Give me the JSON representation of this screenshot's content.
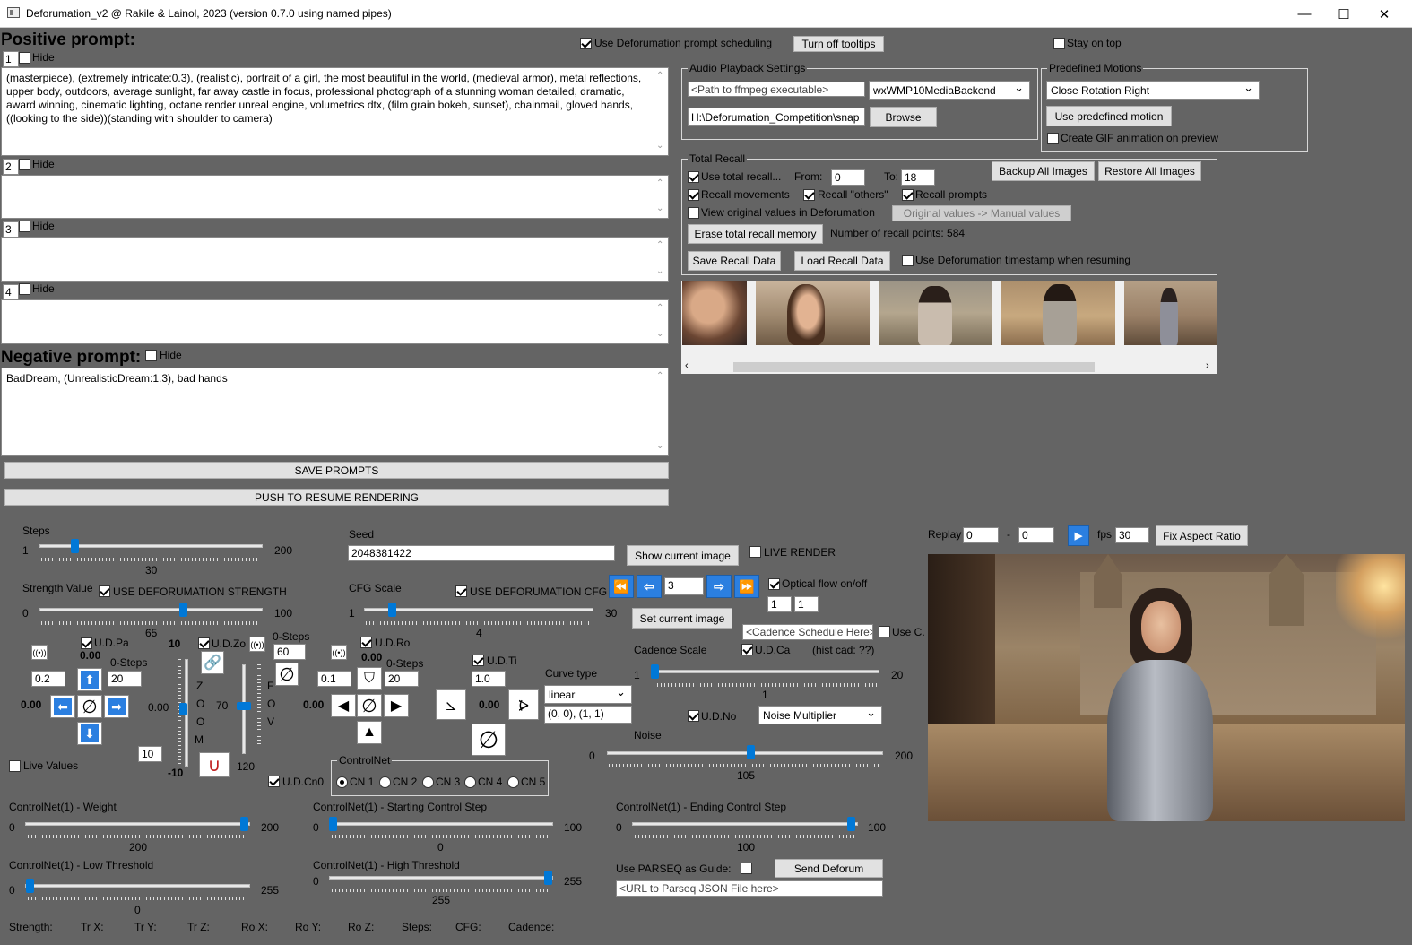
{
  "window": {
    "title": "Deforumation_v2 @ Rakile & Lainol, 2023 (version 0.7.0 using named pipes)"
  },
  "prompts": {
    "positive_header": "Positive prompt:",
    "use_scheduling": "Use Deforumation prompt scheduling",
    "turn_off_tooltips": "Turn off tooltips",
    "stay_on_top": "Stay on top",
    "hide": "Hide",
    "p1_num": "1",
    "p2_num": "2",
    "p3_num": "3",
    "p4_num": "4",
    "p1_text": "(masterpiece), (extremely intricate:0.3), (realistic), portrait of a girl, the most beautiful in the world, (medieval armor), metal reflections, upper body, outdoors, average sunlight, far away castle in focus, professional photograph of a stunning woman detailed, dramatic, award winning, cinematic lighting, octane render unreal engine, volumetrics dtx, (film grain bokeh, sunset), chainmail, gloved hands, ((looking to the side))(standing with shoulder to camera)",
    "negative_header": "Negative prompt:",
    "negative_text": "BadDream, (UnrealisticDream:1.3), bad hands",
    "save_prompts": "SAVE PROMPTS",
    "push_resume": "PUSH TO RESUME RENDERING"
  },
  "audio": {
    "legend": "Audio Playback Settings",
    "ffmpeg_placeholder": "<Path to ffmpeg executable>",
    "backend": "wxWMP10MediaBackend",
    "path": "H:\\Deforumation_Competition\\snap",
    "browse": "Browse"
  },
  "motions": {
    "legend": "Predefined Motions",
    "selected": "Close Rotation Right",
    "use_button": "Use predefined motion",
    "gif": "Create GIF animation on preview"
  },
  "recall": {
    "legend": "Total Recall",
    "use_total": "Use total recall...",
    "from_label": "From:",
    "from_val": "0",
    "to_label": "To:",
    "to_val": "18",
    "backup": "Backup All Images",
    "restore": "Restore All Images",
    "movements": "Recall movements",
    "others": "Recall \"others\"",
    "prompts": "Recall prompts",
    "view_original": "View original values in Deforumation",
    "orig_to_manual": "Original values -> Manual values",
    "erase": "Erase total recall memory",
    "points": "Number of recall points: 584",
    "save": "Save Recall Data",
    "load": "Load Recall Data",
    "timestamp": "Use Deforumation timestamp when resuming"
  },
  "steps": {
    "label": "Steps",
    "min": "1",
    "max": "200",
    "value": "30"
  },
  "strength": {
    "label": "Strength Value",
    "use": "USE DEFORUMATION STRENGTH",
    "min": "0",
    "max": "100",
    "value": "65"
  },
  "seed": {
    "label": "Seed",
    "value": "2048381422",
    "show_image": "Show current image",
    "live_render": "LIVE RENDER"
  },
  "cfg": {
    "label": "CFG Scale",
    "use": "USE DEFORUMATION CFG",
    "min": "1",
    "max": "30",
    "value": "4"
  },
  "nav": {
    "frame": "3",
    "set_image": "Set current image",
    "optical_flow": "Optical flow on/off",
    "of_a": "1",
    "of_b": "1"
  },
  "pan": {
    "udpa": "U.D.Pa",
    "val": "0.00",
    "step": "0.2",
    "zero_steps_label": "0-Steps",
    "zero_steps": "20",
    "left_val": "0.00",
    "ten_top": "10",
    "ten_bottom": "-10",
    "ten_box": "10",
    "mid": "0.00"
  },
  "zoom": {
    "udzo": "U.D.Zo",
    "letters": [
      "Z",
      "O",
      "O",
      "M"
    ],
    "fov_letters": [
      "F",
      "O",
      "V"
    ],
    "val": "70",
    "bottom": "120",
    "zero_steps_label": "0-Steps",
    "zero_steps": "60"
  },
  "rot": {
    "udro": "U.D.Ro",
    "val": "0.00",
    "step": "0.1",
    "zero_steps_label": "0-Steps",
    "zero_steps": "20",
    "left_val": "0.00"
  },
  "tilt": {
    "udti": "U.D.Ti",
    "step": "1.0",
    "val": "0.00"
  },
  "curve": {
    "label": "Curve type",
    "type": "linear",
    "points": "(0, 0), (1, 1)"
  },
  "cadence": {
    "schedule_placeholder": "<Cadence Schedule Here>",
    "use_c": "Use C.",
    "label": "Cadence Scale",
    "udca": "U.D.Ca",
    "hist": "(hist cad: ??)",
    "min": "1",
    "max": "20",
    "value": "1"
  },
  "noise": {
    "udno": "U.D.No",
    "multiplier": "Noise Multiplier",
    "label": "Noise",
    "min": "0",
    "max": "200",
    "value": "105"
  },
  "live_values": "Live Values",
  "udcn0": "U.D.Cn0",
  "controlnet": {
    "legend": "ControlNet",
    "options": [
      "CN 1",
      "CN 2",
      "CN 3",
      "CN 4",
      "CN 5"
    ]
  },
  "cn_weight": {
    "label": "ControlNet(1) - Weight",
    "min": "0",
    "max": "200",
    "value": "200"
  },
  "cn_start": {
    "label": "ControlNet(1) - Starting Control Step",
    "min": "0",
    "max": "100",
    "value": "0"
  },
  "cn_end": {
    "label": "ControlNet(1) - Ending Control Step",
    "min": "0",
    "max": "100",
    "value": "100"
  },
  "cn_low": {
    "label": "ControlNet(1) - Low Threshold",
    "min": "0",
    "max": "255",
    "value": "0"
  },
  "cn_high": {
    "label": "ControlNet(1) - High Threshold",
    "min": "0",
    "max": "255",
    "value": "255"
  },
  "parseq": {
    "label": "Use PARSEQ as Guide:",
    "send": "Send Deforum",
    "url_placeholder": "<URL to Parseq JSON File here>"
  },
  "replay": {
    "label": "Replay",
    "from": "0",
    "dash": "-",
    "to": "0",
    "fps_label": "fps",
    "fps": "30",
    "fix_aspect": "Fix Aspect Ratio"
  },
  "status": {
    "strength": "Strength:",
    "trx": "Tr X:",
    "try": "Tr Y:",
    "trz": "Tr Z:",
    "rox": "Ro X:",
    "roy": "Ro Y:",
    "roz": "Ro Z:",
    "steps": "Steps:",
    "cfg": "CFG:",
    "cadence": "Cadence:"
  }
}
